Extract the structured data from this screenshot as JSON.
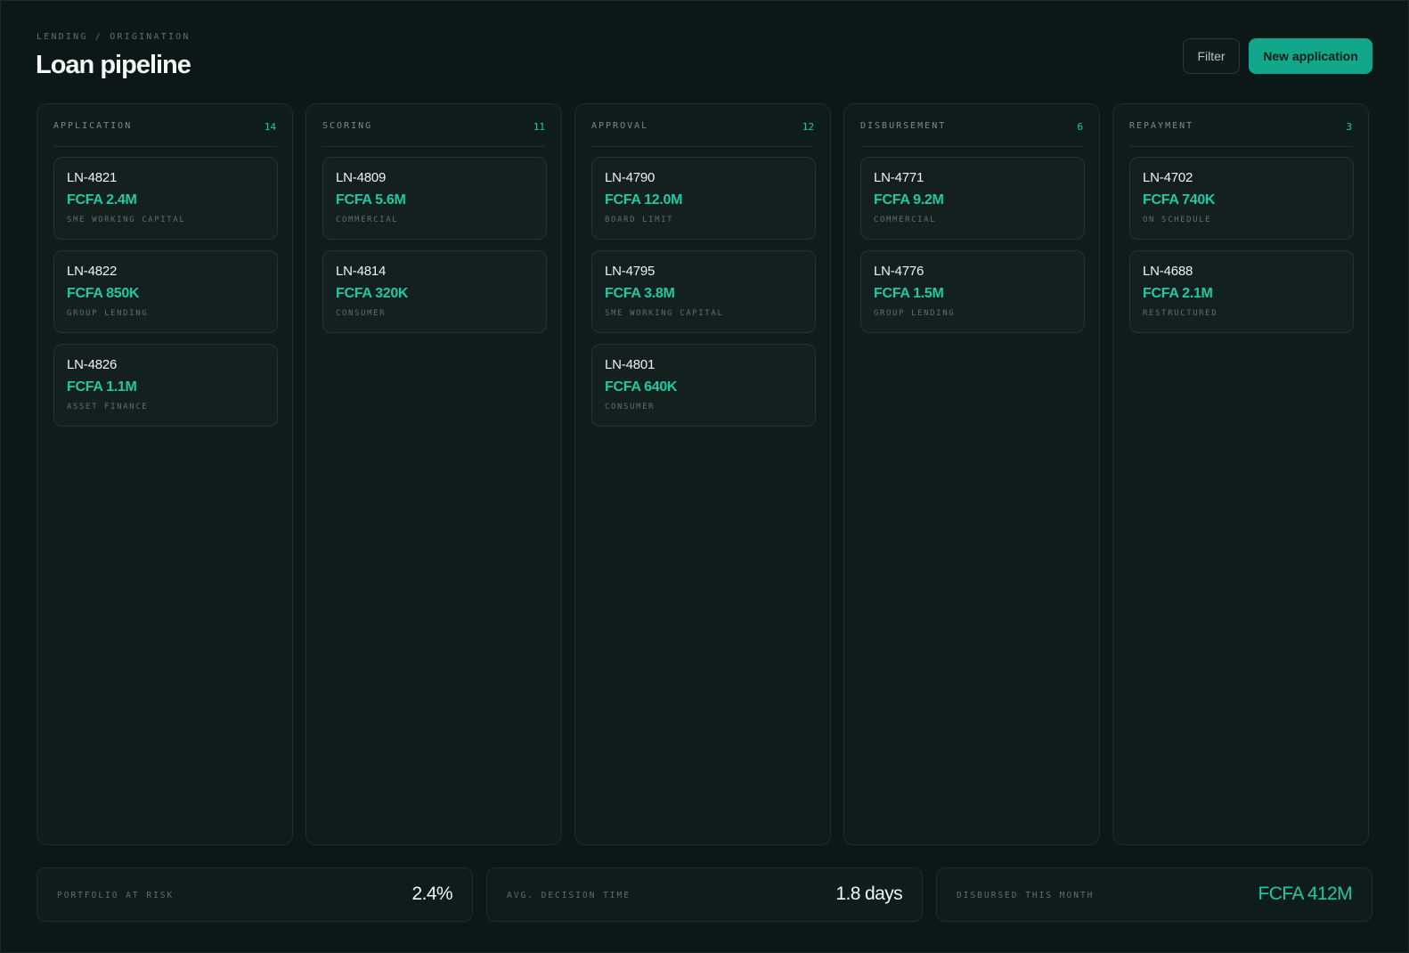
{
  "header": {
    "breadcrumb": "LENDING / ORIGINATION",
    "title": "Loan pipeline",
    "filter_label": "Filter",
    "new_label": "New application"
  },
  "theme": {
    "background": "#0c1717",
    "accent": "#1fc9a2",
    "primary_button": "#12a68a"
  },
  "columns": [
    {
      "name": "APPLICATION",
      "count": "14",
      "cards": [
        {
          "id": "LN-4821",
          "amount": "FCFA 2.4M",
          "type": "SME WORKING CAPITAL"
        },
        {
          "id": "LN-4822",
          "amount": "FCFA 850K",
          "type": "GROUP LENDING"
        },
        {
          "id": "LN-4826",
          "amount": "FCFA 1.1M",
          "type": "ASSET FINANCE"
        }
      ]
    },
    {
      "name": "SCORING",
      "count": "11",
      "cards": [
        {
          "id": "LN-4809",
          "amount": "FCFA 5.6M",
          "type": "COMMERCIAL"
        },
        {
          "id": "LN-4814",
          "amount": "FCFA 320K",
          "type": "CONSUMER"
        }
      ]
    },
    {
      "name": "APPROVAL",
      "count": "12",
      "cards": [
        {
          "id": "LN-4790",
          "amount": "FCFA 12.0M",
          "type": "BOARD LIMIT"
        },
        {
          "id": "LN-4795",
          "amount": "FCFA 3.8M",
          "type": "SME WORKING CAPITAL"
        },
        {
          "id": "LN-4801",
          "amount": "FCFA 640K",
          "type": "CONSUMER"
        }
      ]
    },
    {
      "name": "DISBURSEMENT",
      "count": "6",
      "cards": [
        {
          "id": "LN-4771",
          "amount": "FCFA 9.2M",
          "type": "COMMERCIAL"
        },
        {
          "id": "LN-4776",
          "amount": "FCFA 1.5M",
          "type": "GROUP LENDING"
        }
      ]
    },
    {
      "name": "REPAYMENT",
      "count": "3",
      "cards": [
        {
          "id": "LN-4702",
          "amount": "FCFA 740K",
          "type": "ON SCHEDULE"
        },
        {
          "id": "LN-4688",
          "amount": "FCFA 2.1M",
          "type": "RESTRUCTURED"
        }
      ]
    }
  ],
  "stats": [
    {
      "label": "PORTFOLIO AT RISK",
      "value": "2.4%"
    },
    {
      "label": "AVG. DECISION TIME",
      "value": "1.8 days"
    },
    {
      "label": "DISBURSED THIS MONTH",
      "value": "FCFA 412M"
    }
  ]
}
